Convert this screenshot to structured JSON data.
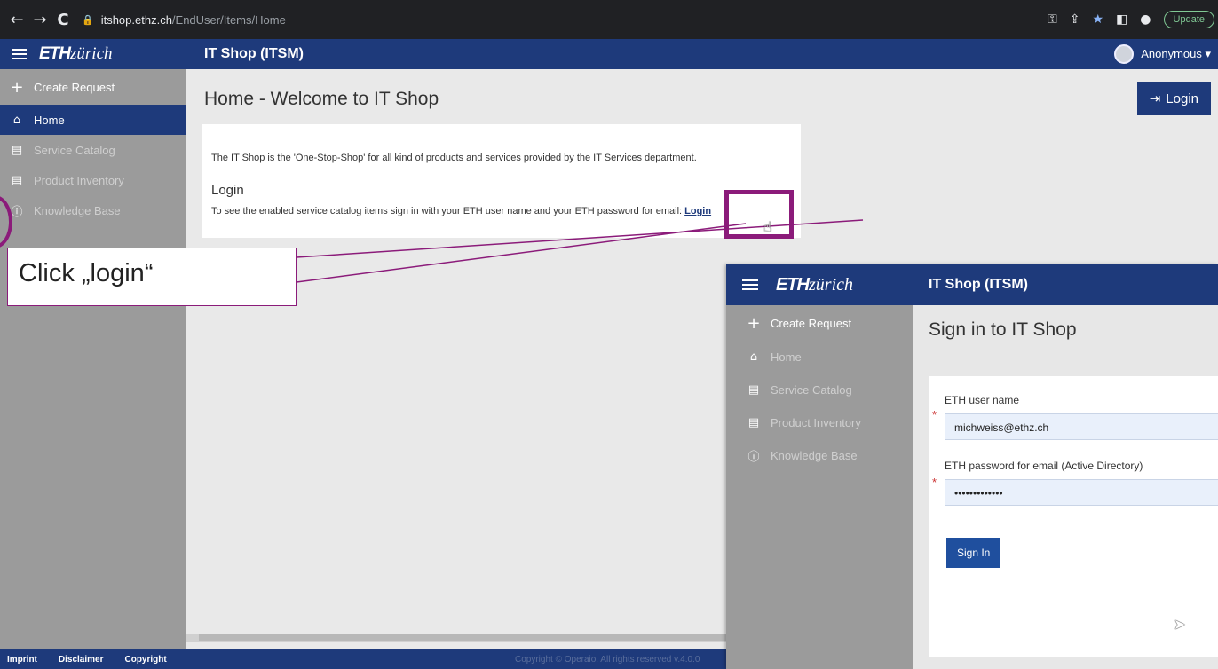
{
  "browser": {
    "back": "←",
    "forward": "→",
    "reload": "C",
    "url_host": "itshop.ethz.ch",
    "url_path": "/EndUser/Items/Home",
    "update_label": "Update"
  },
  "app": {
    "logo_bold": "ETH",
    "logo_italic": "zürich",
    "title": "IT Shop (ITSM)",
    "user": "Anonymous ▾"
  },
  "sidebar": {
    "items": [
      {
        "label": "Create Request",
        "icon": "plus-icon"
      },
      {
        "label": "Home",
        "icon": "home-icon"
      },
      {
        "label": "Service Catalog",
        "icon": "document-icon"
      },
      {
        "label": "Product Inventory",
        "icon": "document-icon"
      },
      {
        "label": "Knowledge Base",
        "icon": "info-icon"
      }
    ]
  },
  "main": {
    "title": "Home - Welcome to IT Shop",
    "login_button": "Login",
    "intro": "The IT Shop is the 'One-Stop-Shop' for all kind of products and services provided by the IT Services department.",
    "login_heading": "Login",
    "login_text": "To see the enabled service catalog items sign in with your ETH user name and your ETH password for email: ",
    "login_link": "Login"
  },
  "footer": {
    "imprint": "Imprint",
    "disclaimer": "Disclaimer",
    "copyright": "Copyright",
    "copy_text": "Copyright © Operaio. All rights reserved v.4.0.0"
  },
  "annotation": {
    "callout": "Click „login“"
  },
  "inset": {
    "title": "Sign in to IT Shop",
    "user_label": "ETH user name",
    "user_value": "michweiss@ethz.ch",
    "password_label": "ETH password for email (Active Directory)",
    "password_value": "•••••••••••••",
    "signin_button": "Sign In",
    "required_mark": "*"
  },
  "colors": {
    "brand": "#1e3a7b",
    "sidebar": "#9b9b9b",
    "annotation": "#8b1b7a"
  }
}
